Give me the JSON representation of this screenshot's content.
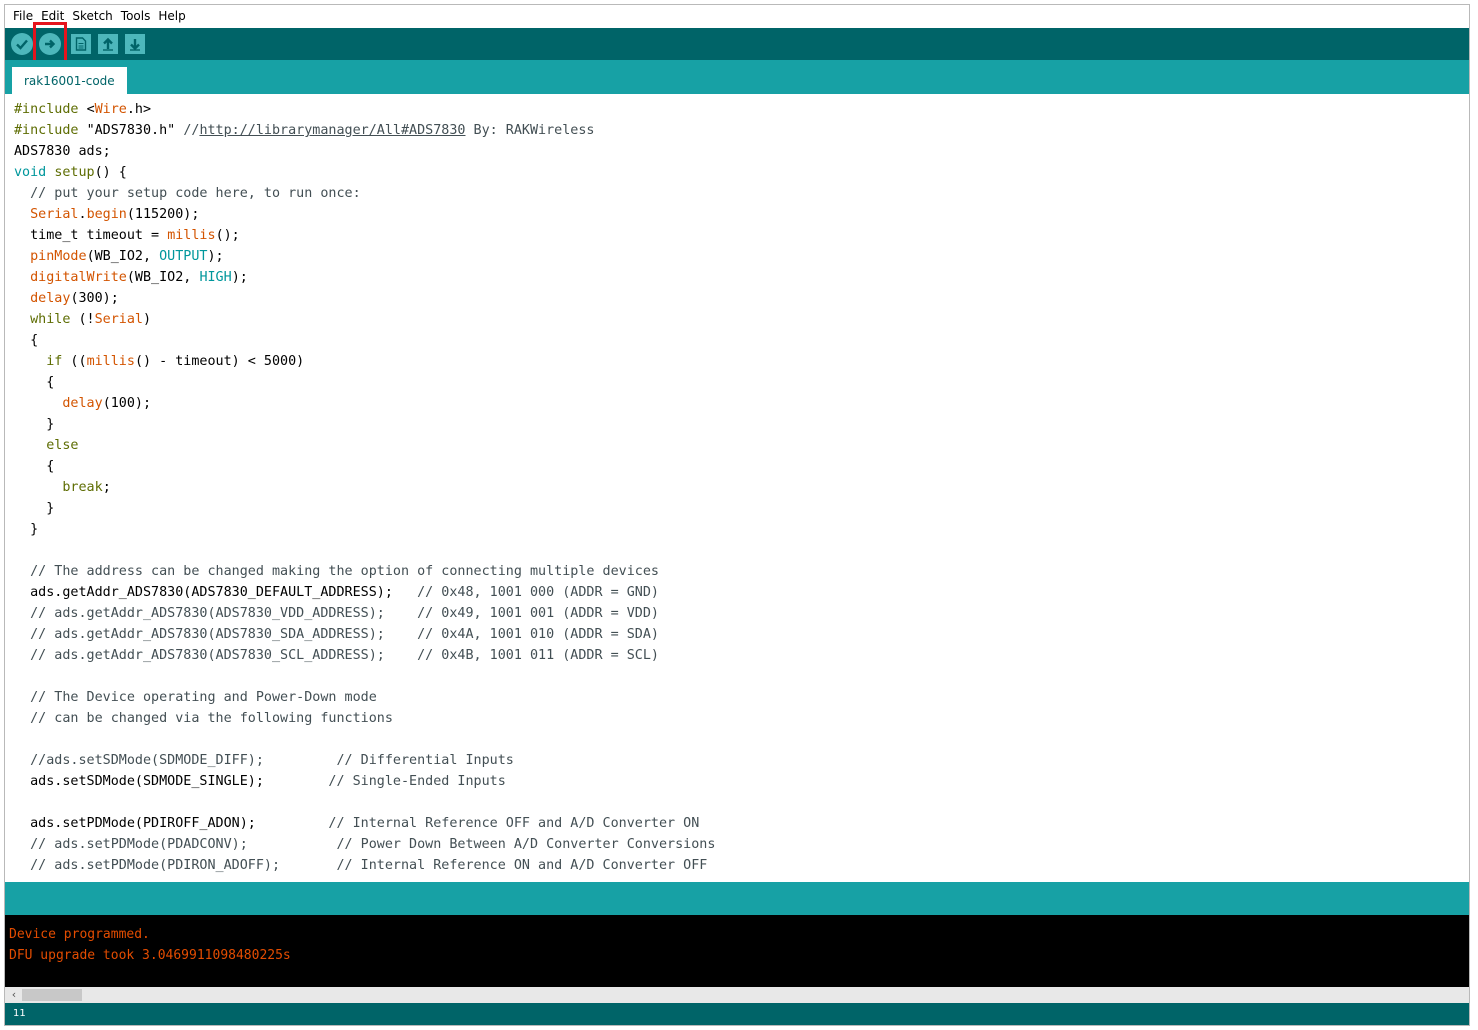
{
  "menu": [
    "File",
    "Edit",
    "Sketch",
    "Tools",
    "Help"
  ],
  "toolbar": {
    "verify_icon": "checkmark-icon",
    "upload_icon": "arrow-right-icon",
    "new_icon": "document-icon",
    "open_icon": "arrow-up-icon",
    "save_icon": "arrow-down-icon",
    "highlight_color": "#e5141d"
  },
  "tab": {
    "label": "rak16001-code"
  },
  "colors": {
    "toolbar_bg": "#006468",
    "tab_bg": "#17a1a5",
    "console_text": "#e34c00"
  },
  "code_lines": [
    [
      [
        "kw",
        "#include "
      ],
      [
        "",
        "<"
      ],
      [
        "fn",
        "Wire"
      ],
      [
        "",
        ".h>"
      ]
    ],
    [
      [
        "kw",
        "#include "
      ],
      [
        "",
        "\"ADS7830.h\" "
      ],
      [
        "cm",
        "//"
      ],
      [
        "lnk",
        "http://librarymanager/All#ADS7830"
      ],
      [
        "cm",
        " By: RAKWireless"
      ]
    ],
    [
      [
        "",
        "ADS7830 ads;"
      ]
    ],
    [
      [
        "tp",
        "void"
      ],
      [
        "",
        " "
      ],
      [
        "kw",
        "setup"
      ],
      [
        "",
        "() {"
      ]
    ],
    [
      [
        "cm",
        "  // put your setup code here, to run once:"
      ]
    ],
    [
      [
        "",
        "  "
      ],
      [
        "fn",
        "Serial"
      ],
      [
        "",
        "."
      ],
      [
        "fn",
        "begin"
      ],
      [
        "",
        "(115200);"
      ]
    ],
    [
      [
        "",
        "  time_t timeout = "
      ],
      [
        "fn",
        "millis"
      ],
      [
        "",
        "();"
      ]
    ],
    [
      [
        "",
        "  "
      ],
      [
        "fn",
        "pinMode"
      ],
      [
        "",
        "(WB_IO2, "
      ],
      [
        "cst",
        "OUTPUT"
      ],
      [
        "",
        ");"
      ]
    ],
    [
      [
        "",
        "  "
      ],
      [
        "fn",
        "digitalWrite"
      ],
      [
        "",
        "(WB_IO2, "
      ],
      [
        "cst",
        "HIGH"
      ],
      [
        "",
        ");"
      ]
    ],
    [
      [
        "",
        "  "
      ],
      [
        "fn",
        "delay"
      ],
      [
        "",
        "(300);"
      ]
    ],
    [
      [
        "",
        "  "
      ],
      [
        "kw",
        "while"
      ],
      [
        "",
        " (!"
      ],
      [
        "fn",
        "Serial"
      ],
      [
        "",
        ")"
      ]
    ],
    [
      [
        "",
        "  {"
      ]
    ],
    [
      [
        "",
        "    "
      ],
      [
        "kw",
        "if"
      ],
      [
        "",
        " (("
      ],
      [
        "fn",
        "millis"
      ],
      [
        "",
        "() - timeout) < 5000)"
      ]
    ],
    [
      [
        "",
        "    {"
      ]
    ],
    [
      [
        "",
        "      "
      ],
      [
        "fn",
        "delay"
      ],
      [
        "",
        "(100);"
      ]
    ],
    [
      [
        "",
        "    }"
      ]
    ],
    [
      [
        "",
        "    "
      ],
      [
        "kw",
        "else"
      ]
    ],
    [
      [
        "",
        "    {"
      ]
    ],
    [
      [
        "",
        "      "
      ],
      [
        "kw",
        "break"
      ],
      [
        "",
        ";"
      ]
    ],
    [
      [
        "",
        "    }"
      ]
    ],
    [
      [
        "",
        "  }"
      ]
    ],
    [
      [
        "",
        ""
      ]
    ],
    [
      [
        "cm",
        "  // The address can be changed making the option of connecting multiple devices"
      ]
    ],
    [
      [
        "",
        "  ads.getAddr_ADS7830(ADS7830_DEFAULT_ADDRESS);   "
      ],
      [
        "cm",
        "// 0x48, 1001 000 (ADDR = GND)"
      ]
    ],
    [
      [
        "cm",
        "  // ads.getAddr_ADS7830(ADS7830_VDD_ADDRESS);    // 0x49, 1001 001 (ADDR = VDD)"
      ]
    ],
    [
      [
        "cm",
        "  // ads.getAddr_ADS7830(ADS7830_SDA_ADDRESS);    // 0x4A, 1001 010 (ADDR = SDA)"
      ]
    ],
    [
      [
        "cm",
        "  // ads.getAddr_ADS7830(ADS7830_SCL_ADDRESS);    // 0x4B, 1001 011 (ADDR = SCL)"
      ]
    ],
    [
      [
        "",
        ""
      ]
    ],
    [
      [
        "cm",
        "  // The Device operating and Power-Down mode"
      ]
    ],
    [
      [
        "cm",
        "  // can be changed via the following functions"
      ]
    ],
    [
      [
        "",
        ""
      ]
    ],
    [
      [
        "cm",
        "  //ads.setSDMode(SDMODE_DIFF);         // Differential Inputs"
      ]
    ],
    [
      [
        "",
        "  ads.setSDMode(SDMODE_SINGLE);        "
      ],
      [
        "cm",
        "// Single-Ended Inputs"
      ]
    ],
    [
      [
        "",
        ""
      ]
    ],
    [
      [
        "",
        "  ads.setPDMode(PDIROFF_ADON);         "
      ],
      [
        "cm",
        "// Internal Reference OFF and A/D Converter ON"
      ]
    ],
    [
      [
        "cm",
        "  // ads.setPDMode(PDADCONV);           // Power Down Between A/D Converter Conversions"
      ]
    ],
    [
      [
        "cm",
        "  // ads.setPDMode(PDIRON_ADOFF);       // Internal Reference ON and A/D Converter OFF"
      ]
    ]
  ],
  "console": [
    "Device programmed.",
    "DFU upgrade took 3.0469911098480225s"
  ],
  "status": {
    "line_number": "11"
  }
}
